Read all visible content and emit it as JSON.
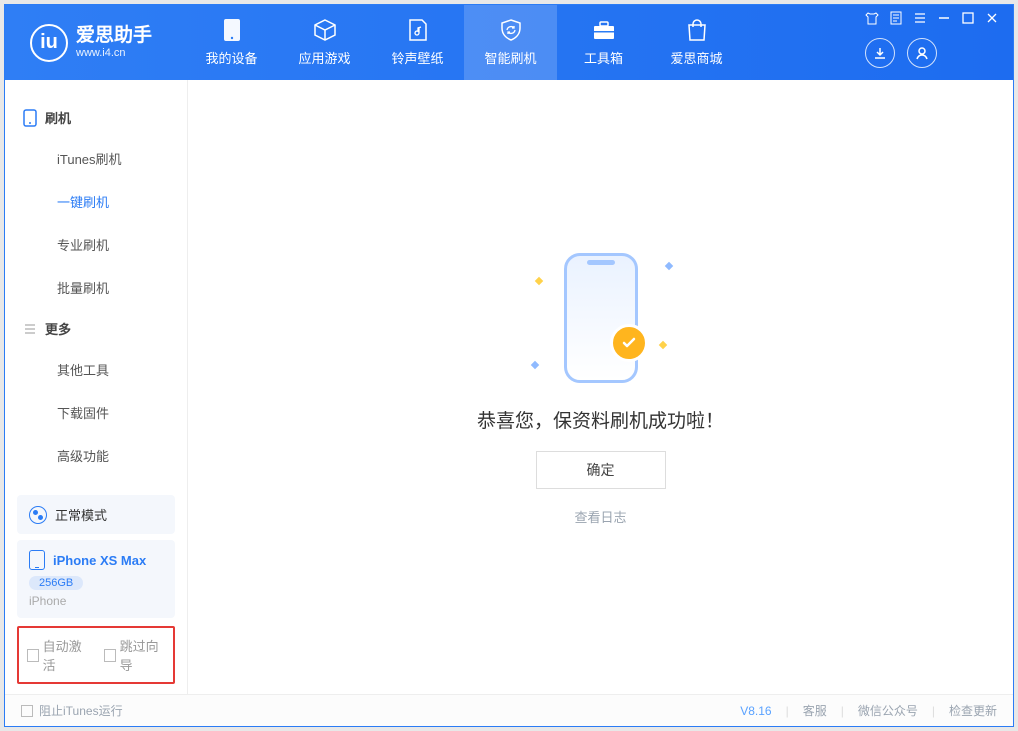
{
  "app": {
    "name": "爱思助手",
    "url": "www.i4.cn"
  },
  "nav": {
    "my_device": "我的设备",
    "apps_games": "应用游戏",
    "ring_wall": "铃声壁纸",
    "smart_flash": "智能刷机",
    "toolbox": "工具箱",
    "store": "爱思商城"
  },
  "sidebar": {
    "group_flash": "刷机",
    "items_flash": {
      "itunes": "iTunes刷机",
      "oneclick": "一键刷机",
      "pro": "专业刷机",
      "batch": "批量刷机"
    },
    "group_more": "更多",
    "items_more": {
      "other_tools": "其他工具",
      "download_fw": "下载固件",
      "advanced": "高级功能"
    }
  },
  "mode": {
    "label": "正常模式"
  },
  "device": {
    "name": "iPhone XS Max",
    "capacity": "256GB",
    "type": "iPhone"
  },
  "options": {
    "auto_activate": "自动激活",
    "skip_guide": "跳过向导"
  },
  "main": {
    "success_text": "恭喜您，保资料刷机成功啦！",
    "ok": "确定",
    "view_log": "查看日志"
  },
  "footer": {
    "block_itunes": "阻止iTunes运行",
    "version": "V8.16",
    "support": "客服",
    "wechat": "微信公众号",
    "check_update": "检查更新"
  }
}
